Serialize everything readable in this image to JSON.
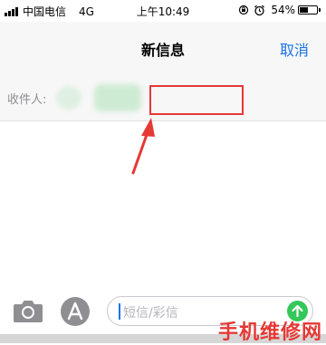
{
  "status_bar": {
    "carrier": "中国电信",
    "network": "4G",
    "time": "上午10:49",
    "battery_text": "54%",
    "battery_level": 0.54,
    "icons": [
      "signal-icon",
      "orientation-lock-icon",
      "alarm-icon",
      "battery-icon"
    ]
  },
  "nav": {
    "title": "新信息",
    "cancel_label": "取消",
    "accent_color": "#1a73e8"
  },
  "recipient": {
    "label": "收件人:"
  },
  "compose": {
    "placeholder": "短信/彩信",
    "icons": [
      "camera-icon",
      "app-store-icon",
      "send-arrow-icon"
    ],
    "send_color": "#34c759"
  },
  "annotation": {
    "highlight_color": "#e53935"
  },
  "watermark": {
    "text": "手机维修网"
  }
}
